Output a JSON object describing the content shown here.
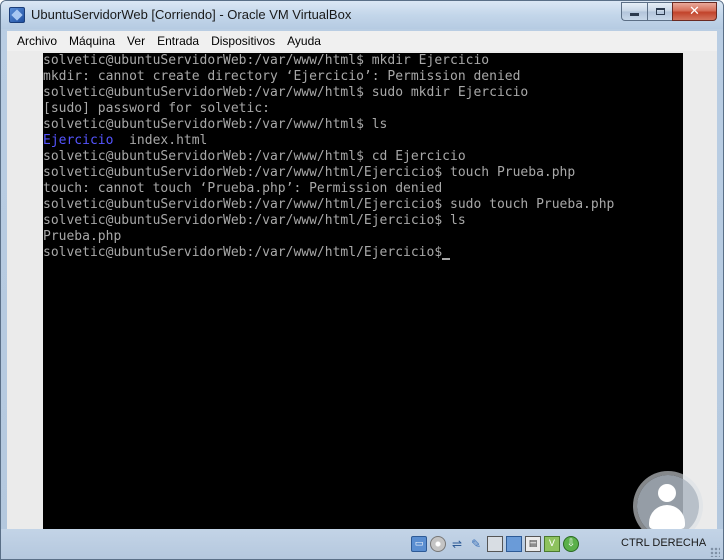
{
  "window": {
    "title": "UbuntuServidorWeb [Corriendo] - Oracle VM VirtualBox",
    "close_glyph": "✕"
  },
  "menu": {
    "items": [
      {
        "label": "Archivo"
      },
      {
        "label": "Máquina"
      },
      {
        "label": "Ver"
      },
      {
        "label": "Entrada"
      },
      {
        "label": "Dispositivos"
      },
      {
        "label": "Ayuda"
      }
    ]
  },
  "terminal": {
    "lines": [
      "solvetic@ubuntuServidorWeb:/var/www/html$ mkdir Ejercicio",
      "mkdir: cannot create directory ‘Ejercicio’: Permission denied",
      "solvetic@ubuntuServidorWeb:/var/www/html$ sudo mkdir Ejercicio",
      "[sudo] password for solvetic:",
      "solvetic@ubuntuServidorWeb:/var/www/html$ ls",
      "",
      "solvetic@ubuntuServidorWeb:/var/www/html$ cd Ejercicio",
      "solvetic@ubuntuServidorWeb:/var/www/html/Ejercicio$ touch Prueba.php",
      "touch: cannot touch ‘Prueba.php’: Permission denied",
      "solvetic@ubuntuServidorWeb:/var/www/html/Ejercicio$ sudo touch Prueba.php",
      "solvetic@ubuntuServidorWeb:/var/www/html/Ejercicio$ ls",
      "Prueba.php",
      "solvetic@ubuntuServidorWeb:/var/www/html/Ejercicio$"
    ],
    "ls_output": {
      "dir_name": "Ejercicio",
      "file_name": "index.html"
    },
    "colors": {
      "text": "#a8a8a8",
      "directory": "#5555ff",
      "background": "#000000"
    }
  },
  "statusbar": {
    "icons": [
      "hard-disk-icon",
      "optical-drive-icon",
      "usb-icon",
      "shared-folders-icon",
      "display-icon",
      "network-icon",
      "video-capture-icon",
      "cpu-virtualization-icon",
      "mouse-integration-icon"
    ],
    "host_key": "CTRL DERECHA"
  }
}
